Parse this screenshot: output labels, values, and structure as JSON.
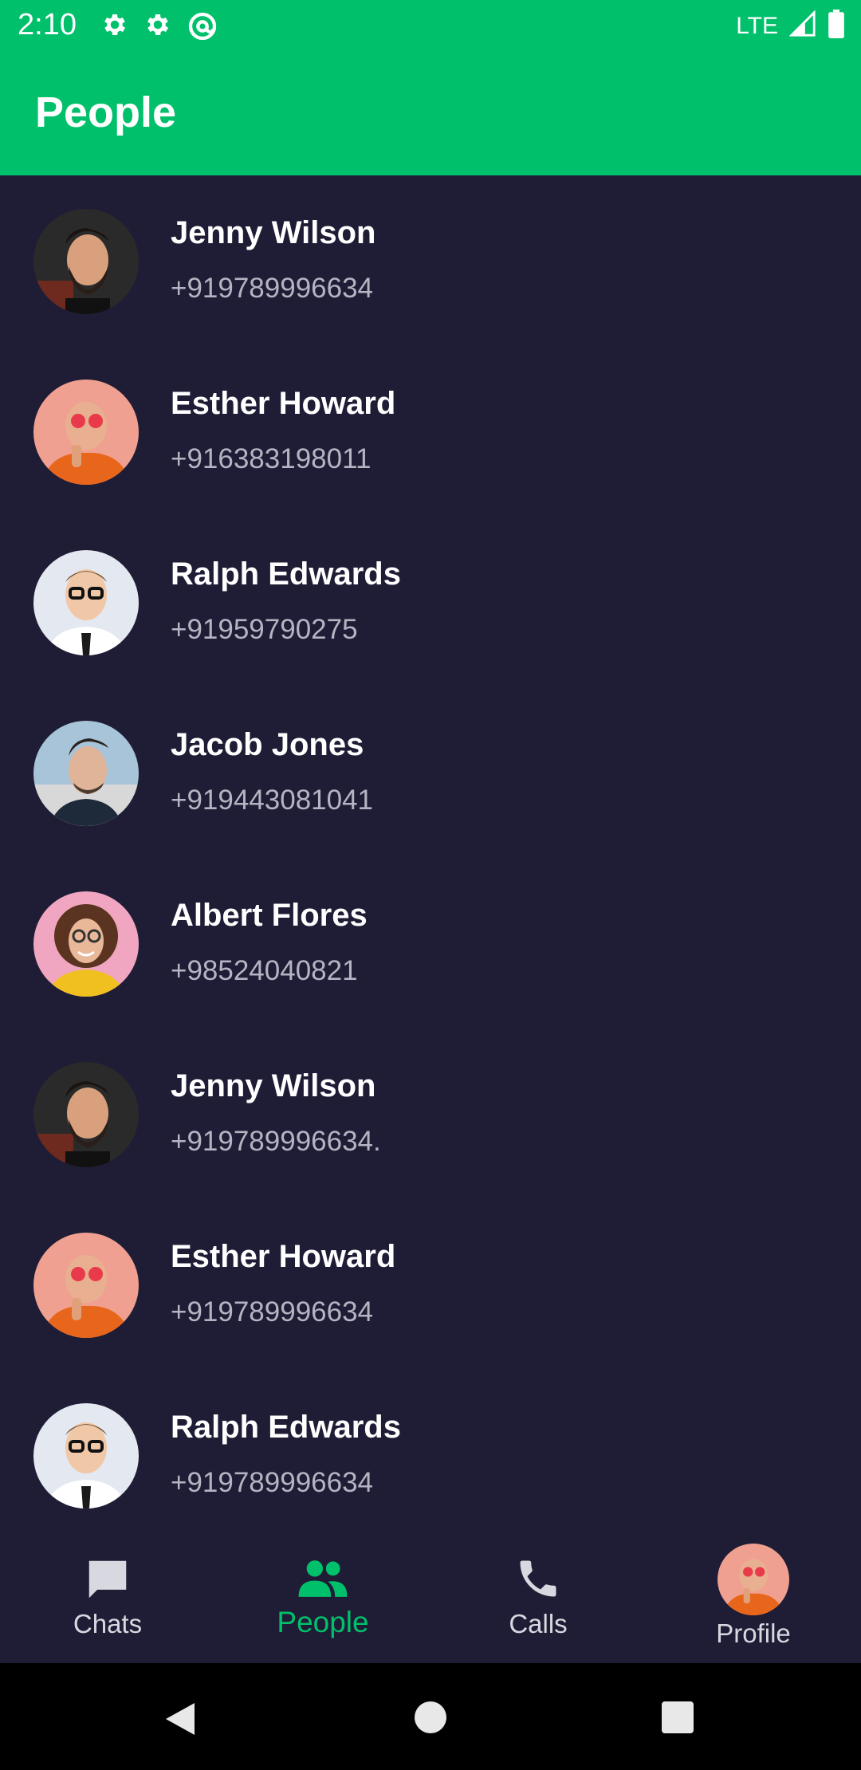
{
  "status_bar": {
    "time": "2:10",
    "network": "LTE",
    "icons": [
      "gear-icon",
      "gear-icon",
      "at-sign-icon",
      "signal-icon",
      "battery-icon"
    ]
  },
  "app_bar": {
    "title": "People"
  },
  "contacts": [
    {
      "name": "Jenny Wilson",
      "phone": "+919789996634",
      "avatar": "bearded-man"
    },
    {
      "name": "Esther Howard",
      "phone": "+916383198011",
      "avatar": "orange-hoodie"
    },
    {
      "name": "Ralph Edwards",
      "phone": "+91959790275",
      "avatar": "glasses-man"
    },
    {
      "name": "Jacob Jones",
      "phone": "+919443081041",
      "avatar": "stylish-man"
    },
    {
      "name": "Albert Flores",
      "phone": "+98524040821",
      "avatar": "curly-woman"
    },
    {
      "name": "Jenny Wilson",
      "phone": "+919789996634.",
      "avatar": "bearded-man"
    },
    {
      "name": "Esther Howard",
      "phone": "+919789996634",
      "avatar": "orange-hoodie"
    },
    {
      "name": "Ralph Edwards",
      "phone": "+919789996634",
      "avatar": "glasses-man"
    }
  ],
  "bottom_nav": {
    "items": [
      {
        "label": "Chats",
        "icon": "chat-icon",
        "active": false
      },
      {
        "label": "People",
        "icon": "people-icon",
        "active": true
      },
      {
        "label": "Calls",
        "icon": "phone-icon",
        "active": false
      },
      {
        "label": "Profile",
        "icon": "profile-avatar",
        "active": false
      }
    ]
  },
  "colors": {
    "accent": "#00c06b",
    "background": "#1f1d36",
    "secondary_text": "#b4b4c2"
  }
}
